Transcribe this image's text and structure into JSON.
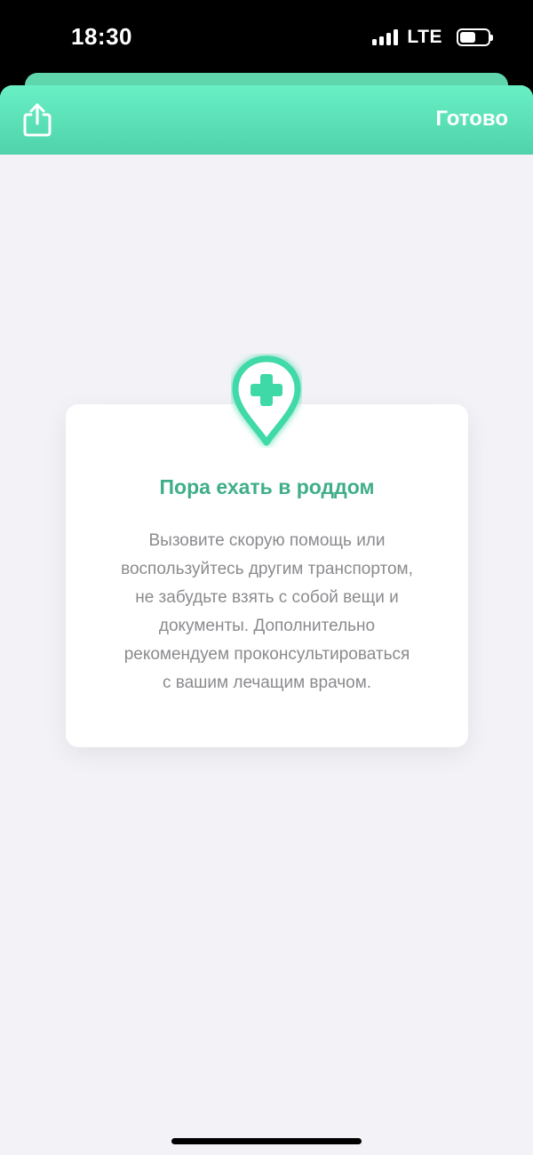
{
  "status_bar": {
    "time": "18:30",
    "network": "LTE",
    "battery_level": 0.58
  },
  "nav": {
    "done_label": "Готово",
    "share_icon": "share-icon"
  },
  "card": {
    "icon": "medical-location-pin-icon",
    "title": "Пора ехать в роддом",
    "lines": [
      "Вызовите скорую помощь или",
      "воспользуйтесь другим транспортом,",
      "не забудьте взять с собой вещи и",
      "документы. Дополнительно",
      "рекомендуем проконсультироваться",
      "с вашим лечащим врачом."
    ]
  },
  "colors": {
    "accent": "#4fd2aa",
    "title": "#3fae88",
    "background": "#f2f2f7"
  }
}
